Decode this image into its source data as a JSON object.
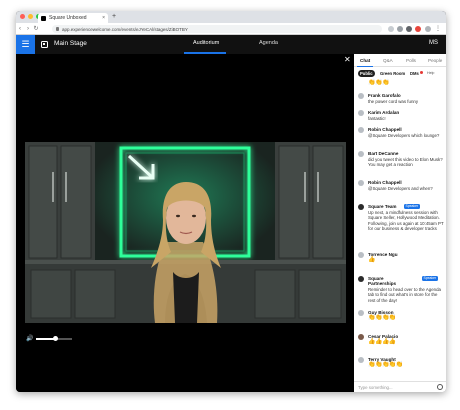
{
  "browser": {
    "tab_title": "Square Unboxed",
    "tab_close": "×",
    "new_tab": "+",
    "nav_back": "‹",
    "nav_forward": "›",
    "nav_reload": "↻",
    "url": "app.experiencewelcome.com/events/eJYeCAl/stages/ZiBOTBY"
  },
  "app": {
    "menu_icon": "☰",
    "stage_name": "Main Stage",
    "tabs": [
      "Auditorium",
      "Agenda"
    ],
    "active_tab": "Auditorium",
    "user_initials": "MS",
    "close_icon": "✕"
  },
  "panel": {
    "tabs": [
      "Chat",
      "Q&A",
      "Polls",
      "People"
    ],
    "active_tab": "Chat",
    "subtabs": [
      "Public",
      "Green Room",
      "DMs",
      "Help"
    ],
    "active_subtab": "Public",
    "top_emoji": "👏👏👏",
    "messages": [
      {
        "name": "Frank Garofalo",
        "text": "the power cord was funny"
      },
      {
        "name": "Karim Ardalan",
        "text": "fantastic!"
      },
      {
        "name": "Robin Chappell",
        "text": "@Square Developers which lounge?"
      },
      {
        "name": "Bart DeCanne",
        "text": "did you tweet this video to Elon Musk? You may get a reaction"
      },
      {
        "name": "Robin Chappell",
        "text": "@Square Developers and when?"
      },
      {
        "name": "Square Team",
        "badge": "Speaker",
        "text": "Up next, a mindfulness session with Square Seller, Hollywood Meditation. Following, join us again at 10:45am PT for our business & developer tracks"
      },
      {
        "name": "Torrence Ngu",
        "emoji": "👍"
      },
      {
        "name": "Square Partnerships",
        "badge": "Speaker",
        "text": "Reminder to head over to the Agenda tab to find out what's in store for the rest of the day!"
      },
      {
        "name": "Guy Bisson",
        "emoji": "👏👏👏👏"
      },
      {
        "name": "Cesar Palacio",
        "emoji": "👍👍👍👍"
      },
      {
        "name": "Terry Vaught",
        "emoji": "👏👏👏👏👏"
      }
    ],
    "input_placeholder": "Type something..."
  },
  "colors": {
    "accent": "#1a73e8",
    "neon": "#2dff9a",
    "speaker_badge": "#1a73e8"
  }
}
